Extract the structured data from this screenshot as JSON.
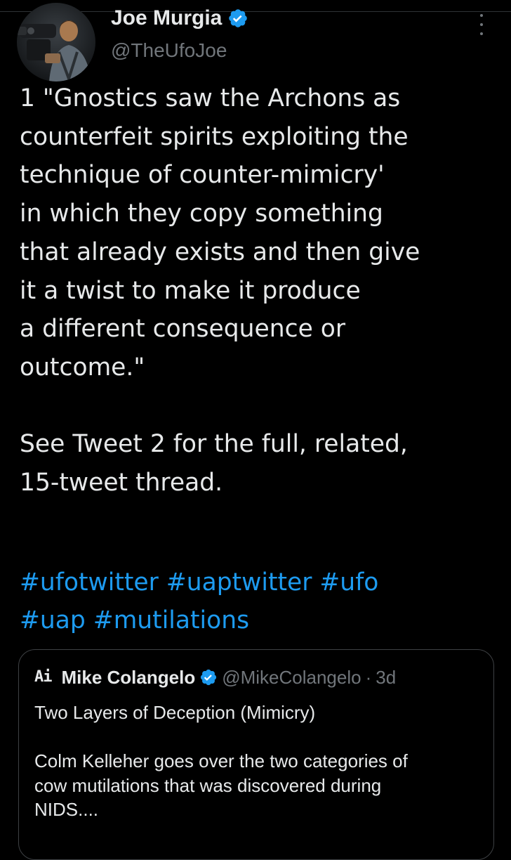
{
  "tweet": {
    "author_name": "Joe Murgia",
    "handle": "@TheUfoJoe",
    "body": "1 \"Gnostics saw the Archons as\ncounterfeit spirits exploiting the\ntechnique of counter-mimicry'\nin which they copy something\nthat already exists and then give\nit a twist to make it produce\na different consequence or\noutcome.\"\n\nSee Tweet 2 for the full, related,\n15-tweet thread.",
    "hashtags": [
      "#ufotwitter",
      "#uaptwitter",
      "#ufo",
      "#uap",
      "#mutilations"
    ]
  },
  "quoted_tweet": {
    "avatar_text": "Ai",
    "author_name": "Mike Colangelo",
    "handle": "@MikeColangelo",
    "separator": "·",
    "time": "3d",
    "text": "Two Layers of Deception (Mimicry)\n\nColm Kelleher goes over the two categories of\ncow mutilations that was discovered during\nNIDS...."
  },
  "colors": {
    "background": "#000000",
    "text": "#e7e9ea",
    "secondary_text": "#71767b",
    "accent": "#1d9bf0",
    "border": "#3e4144"
  },
  "icons": {
    "verified": "verified-badge-icon",
    "more": "more-options-icon"
  }
}
